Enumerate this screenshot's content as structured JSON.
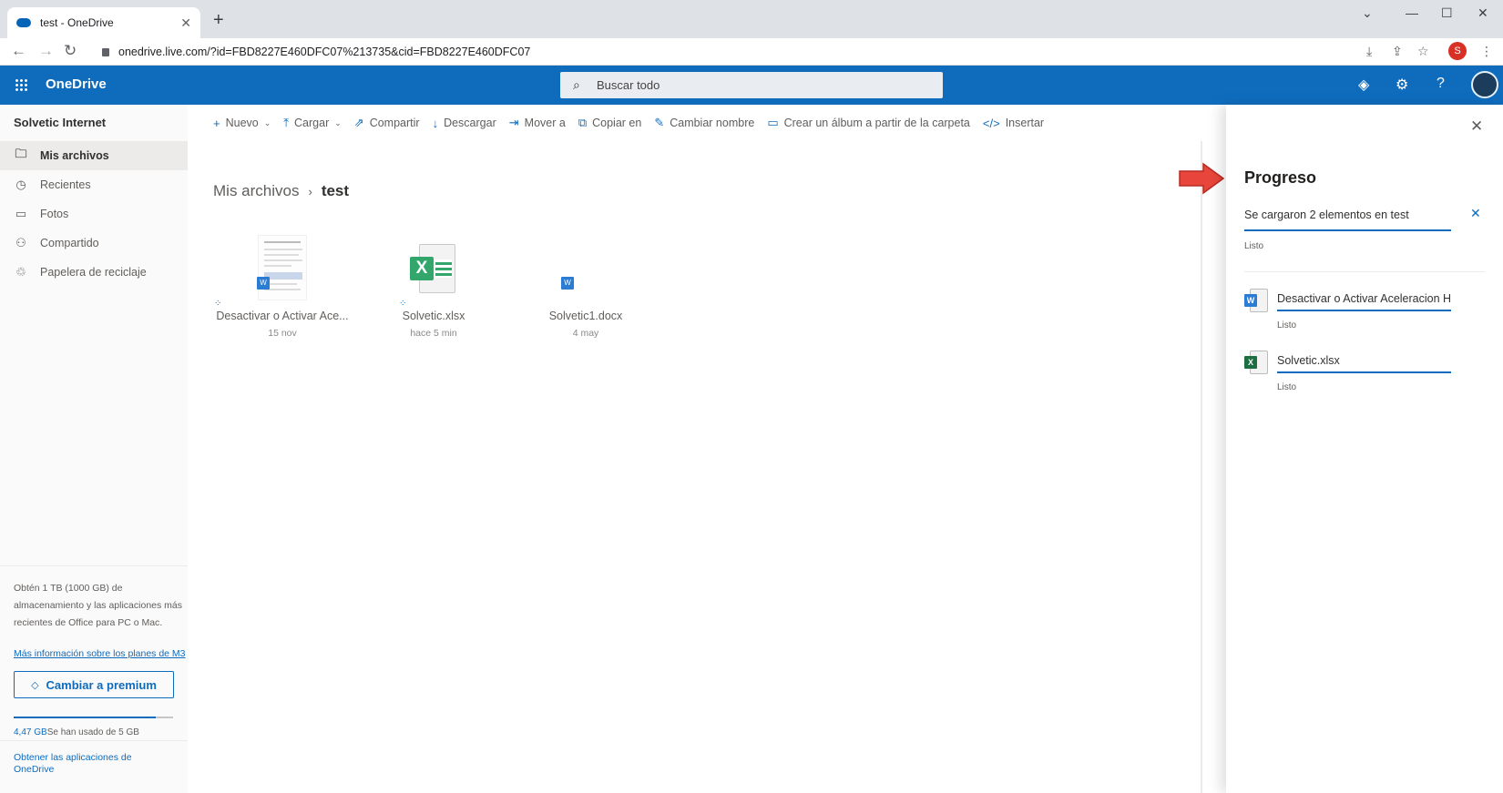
{
  "browser": {
    "tab_title": "test - OneDrive",
    "url": "onedrive.live.com/?id=FBD8227E460DFC07%213735&cid=FBD8227E460DFC07",
    "profile_initial": "S"
  },
  "suite": {
    "app_name": "OneDrive",
    "search_placeholder": "Buscar todo"
  },
  "sidebar": {
    "account": "Solvetic Internet",
    "items": [
      {
        "label": "Mis archivos",
        "icon": "folder-icon",
        "active": true
      },
      {
        "label": "Recientes",
        "icon": "history-icon"
      },
      {
        "label": "Fotos",
        "icon": "photo-icon"
      },
      {
        "label": "Compartido",
        "icon": "people-icon"
      },
      {
        "label": "Papelera de reciclaje",
        "icon": "recycle-bin-icon"
      }
    ],
    "promo": "Obtén 1 TB (1000 GB) de almacenamiento y las aplicaciones más recientes de Office para PC o Mac.",
    "promo_link": "Más información sobre los planes de M3",
    "premium_button": "Cambiar a premium",
    "quota_used": "4,47 GB",
    "quota_text": "Se han usado de 5 GB",
    "quota_fraction": 0.894,
    "get_apps": "Obtener las aplicaciones de OneDrive"
  },
  "commands": {
    "new": "Nuevo",
    "upload": "Cargar",
    "share": "Compartir",
    "download": "Descargar",
    "move": "Mover a",
    "copy": "Copiar en",
    "rename": "Cambiar nombre",
    "album": "Crear un álbum a partir de la carpeta",
    "embed": "Insertar"
  },
  "breadcrumb": {
    "root": "Mis archivos",
    "current": "test"
  },
  "files": [
    {
      "name": "Desactivar o Activar Ace...",
      "date": "15 nov",
      "type": "docx"
    },
    {
      "name": "Solvetic.xlsx",
      "date": "hace 5 min",
      "type": "xlsx"
    },
    {
      "name": "Solvetic1.docx",
      "date": "4 may",
      "type": "docx"
    }
  ],
  "progress_panel": {
    "title": "Progreso",
    "summary": "Se cargaron 2 elementos en test",
    "summary_status": "Listo",
    "items": [
      {
        "name": "Desactivar o Activar Aceleracion H...",
        "status": "Listo",
        "type": "docx"
      },
      {
        "name": "Solvetic.xlsx",
        "status": "Listo",
        "type": "xlsx"
      }
    ]
  },
  "colors": {
    "accent": "#0f6cbd",
    "excel": "#33a66c",
    "word": "#2b7cd3",
    "annotation_arrow": "#e8463c"
  }
}
